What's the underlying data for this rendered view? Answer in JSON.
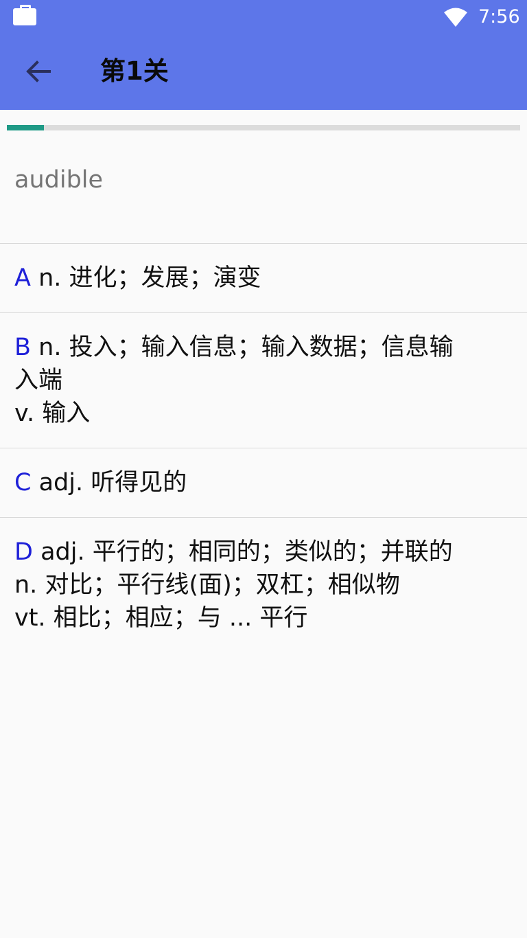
{
  "status_bar": {
    "time": "7:56",
    "icons": [
      "briefcase-icon",
      "wifi-icon"
    ]
  },
  "app_bar": {
    "back_icon": "arrow-left-icon",
    "title": "第1关"
  },
  "progress": {
    "value_fraction": 0.072,
    "fill_color": "#1f9a86",
    "track_color": "#dcdcdc"
  },
  "question": {
    "word": "audible"
  },
  "options": [
    {
      "letter": "A",
      "lines": [
        "n. 进化；发展；演变"
      ]
    },
    {
      "letter": "B",
      "lines": [
        "n. 投入；输入信息；输入数据；信息输",
        "入端",
        "v. 输入"
      ]
    },
    {
      "letter": "C",
      "lines": [
        "adj. 听得见的"
      ]
    },
    {
      "letter": "D",
      "lines": [
        "adj. 平行的；相同的；类似的；并联的",
        "n. 对比；平行线(面)；双杠；相似物",
        "vt. 相比；相应；与 ... 平行"
      ]
    }
  ],
  "colors": {
    "primary": "#5d76e9",
    "accent": "#1f9a86",
    "option_letter": "#1e20d8"
  }
}
